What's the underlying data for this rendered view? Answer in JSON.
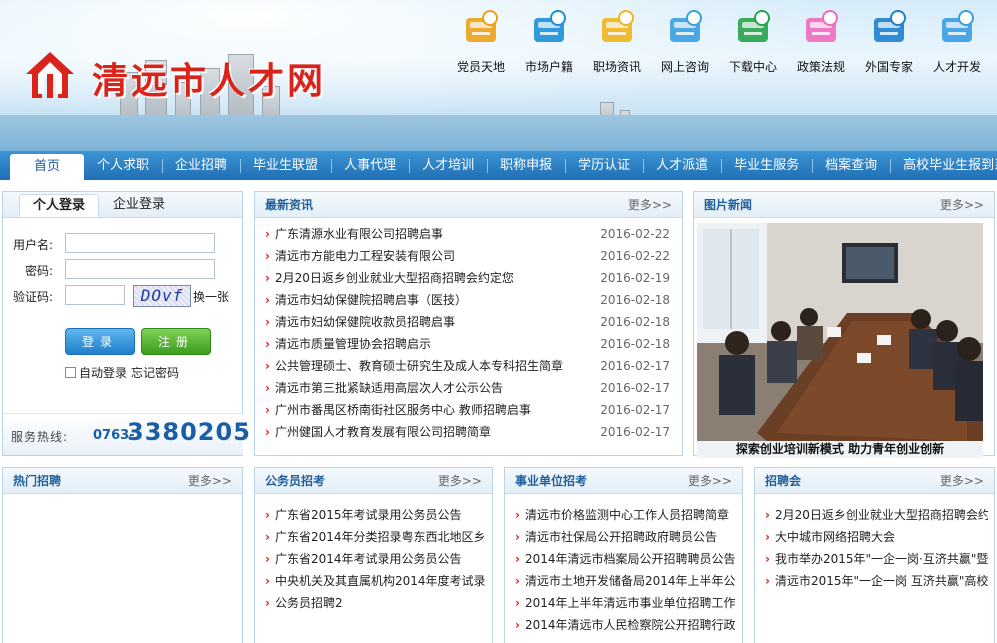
{
  "site": {
    "name": "清远市人才网"
  },
  "topnav": [
    {
      "label": "党员天地",
      "icon": "party-member-icon",
      "color": "#e9a21a"
    },
    {
      "label": "市场户籍",
      "icon": "file-stack-icon",
      "color": "#1a8fd8"
    },
    {
      "label": "职场资讯",
      "icon": "people-group-icon",
      "color": "#f0b51c"
    },
    {
      "label": "网上咨询",
      "icon": "computer-consult-icon",
      "color": "#3aa0e0"
    },
    {
      "label": "下载中心",
      "icon": "download-hand-icon",
      "color": "#27a34a"
    },
    {
      "label": "政策法规",
      "icon": "policy-document-icon",
      "color": "#f06ac0"
    },
    {
      "label": "外国专家",
      "icon": "foreign-expert-icon",
      "color": "#1d7fd0"
    },
    {
      "label": "人才开发",
      "icon": "talent-development-icon",
      "color": "#3b9de3"
    }
  ],
  "mainnav": [
    "首页",
    "个人求职",
    "企业招聘",
    "毕业生联盟",
    "人事代理",
    "人才培训",
    "职称申报",
    "学历认证",
    "人才派遣",
    "毕业生服务",
    "档案查询",
    "高校毕业生报到系统"
  ],
  "login": {
    "tabs": [
      "个人登录",
      "企业登录"
    ],
    "username_label": "用户名:",
    "password_label": "密码:",
    "captcha_label": "验证码:",
    "captcha_text": "DOvf",
    "refresh_label": "换一张",
    "login_button": "登录",
    "register_button": "注册",
    "auto_login": "自动登录",
    "forgot_password": "忘记密码",
    "hotline_label": "服务热线:",
    "hotline_area": "0763-",
    "hotline_number": "3380205"
  },
  "latest_news": {
    "title": "最新资讯",
    "more": "更多>>",
    "items": [
      {
        "title": "广东清源水业有限公司招聘启事",
        "date": "2016-02-22"
      },
      {
        "title": "清远市方能电力工程安装有限公司",
        "date": "2016-02-22"
      },
      {
        "title": "2月20日返乡创业就业大型招商招聘会约定您",
        "date": "2016-02-19"
      },
      {
        "title": "清远市妇幼保健院招聘启事（医技）",
        "date": "2016-02-18"
      },
      {
        "title": "清远市妇幼保健院收款员招聘启事",
        "date": "2016-02-18"
      },
      {
        "title": "清远市质量管理协会招聘启示",
        "date": "2016-02-18"
      },
      {
        "title": "公共管理硕士、教育硕士研究生及成人本专科招生简章",
        "date": "2016-02-17"
      },
      {
        "title": "清远市第三批紧缺适用高层次人才公示公告",
        "date": "2016-02-17"
      },
      {
        "title": "广州市番禺区桥南街社区服务中心 教师招聘启事",
        "date": "2016-02-17"
      },
      {
        "title": "广州健国人才教育发展有限公司招聘简章",
        "date": "2016-02-17"
      }
    ]
  },
  "photo_news": {
    "title": "图片新闻",
    "more": "更多>>",
    "caption": "探索创业培训新模式 助力青年创业创新"
  },
  "hot_jobs": {
    "title": "热门招聘",
    "more": "更多>>"
  },
  "civil_service": {
    "title": "公务员招考",
    "more": "更多>>",
    "items": [
      "广东省2015年考试录用公务员公告",
      "广东省2014年分类招录粤东西北地区乡镇",
      "广东省2014年考试录用公务员公告",
      "中央机关及其直属机构2014年度考试录用",
      "公务员招聘2"
    ]
  },
  "public_institution": {
    "title": "事业单位招考",
    "more": "更多>>",
    "items": [
      "清远市价格监测中心工作人员招聘简章",
      "清远市社保局公开招聘政府聘员公告",
      "2014年清远市档案局公开招聘聘员公告",
      "清远市土地开发储备局2014年上半年公开",
      "2014年上半年清远市事业单位招聘工作人",
      "2014年清远市人民检察院公开招聘行政辅"
    ]
  },
  "job_fair": {
    "title": "招聘会",
    "more": "更多>>",
    "items": [
      "2月20日返乡创业就业大型招商招聘会约",
      "大中城市网络招聘大会",
      "我市举办2015年\"一企一岗·互济共赢\"暨",
      "清远市2015年\"一企一岗 互济共赢\"高校"
    ]
  }
}
